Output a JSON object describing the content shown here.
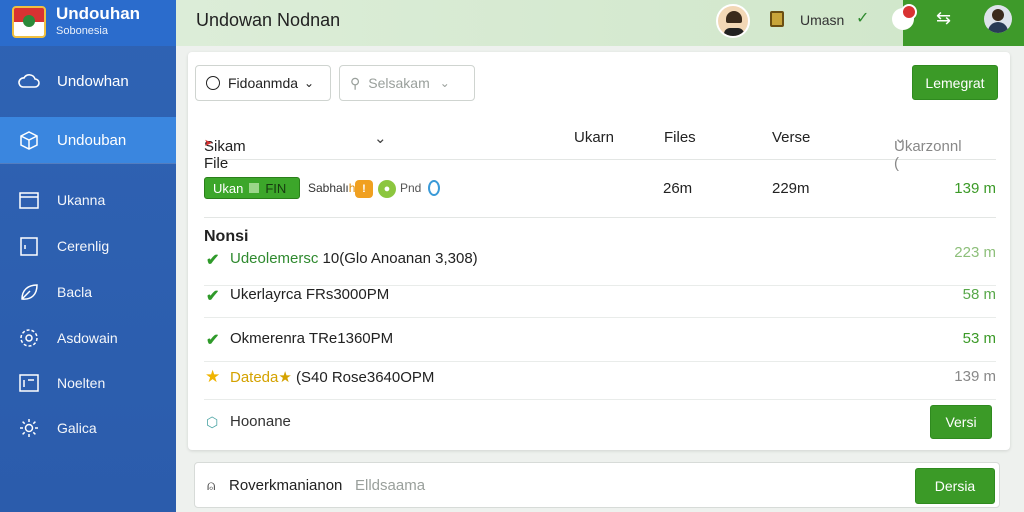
{
  "brand": {
    "name": "Undouhan",
    "subtitle": "Sobonesia"
  },
  "sidebar": {
    "items": [
      {
        "label": "Undowhan",
        "icon": "cloud-icon"
      },
      {
        "label": "Undouban",
        "icon": "box-icon"
      },
      {
        "label": "Ukanna",
        "icon": "calendar-icon"
      },
      {
        "label": "Cerenlig",
        "icon": "clipboard-icon"
      },
      {
        "label": "Bacla",
        "icon": "leaf-icon"
      },
      {
        "label": "Asdowain",
        "icon": "gear-icon"
      },
      {
        "label": "Noelten",
        "icon": "document-icon"
      },
      {
        "label": "Galica",
        "icon": "settings-icon"
      }
    ]
  },
  "topbar": {
    "title": "Undowan Nodnan",
    "user": "Umasn"
  },
  "toolbar": {
    "select1": "Fidoanmda",
    "select2_placeholder": "Selsakam",
    "action_button": "Lemegrat"
  },
  "table": {
    "headers": [
      "Sikam File",
      "Ukarn",
      "Files",
      "Verse",
      "Ukarzonnl ("
    ],
    "header_badge": "➤",
    "row1": {
      "tag_left": "Ukan",
      "tag_right": "FIN",
      "small_label": "Sabhalı",
      "small_label_accent": "h",
      "pnd": "Pnd",
      "col2": "26m",
      "col3": "229m",
      "col4": "139 m"
    }
  },
  "section": {
    "title": "Nonsi",
    "items": [
      {
        "prefix": "Udeolemersc",
        "text": " 10(Glo  Anoanan 3,308)",
        "value": "223 m",
        "marker": "check"
      },
      {
        "prefix": "",
        "text": "Ukerlayrca FRs3000PM",
        "value": "58 m",
        "marker": "check"
      },
      {
        "prefix": "",
        "text": "Okmerenra TRe1360PM",
        "value": "53 m",
        "marker": "check"
      },
      {
        "prefix": "Dateda★",
        "text": " (S40 Rose3640OPM",
        "value": "139 m",
        "marker": "star"
      }
    ],
    "footer_label": "Hoonane",
    "footer_button": "Versi"
  },
  "bottombar": {
    "label": "Roverkmanianon",
    "placeholder": "Elldsaama",
    "button": "Dersia"
  },
  "colors": {
    "sidebar": "#2f63b4",
    "active": "#3a86df",
    "accent_green": "#3b9a27",
    "topbar": "#d5ead0"
  }
}
